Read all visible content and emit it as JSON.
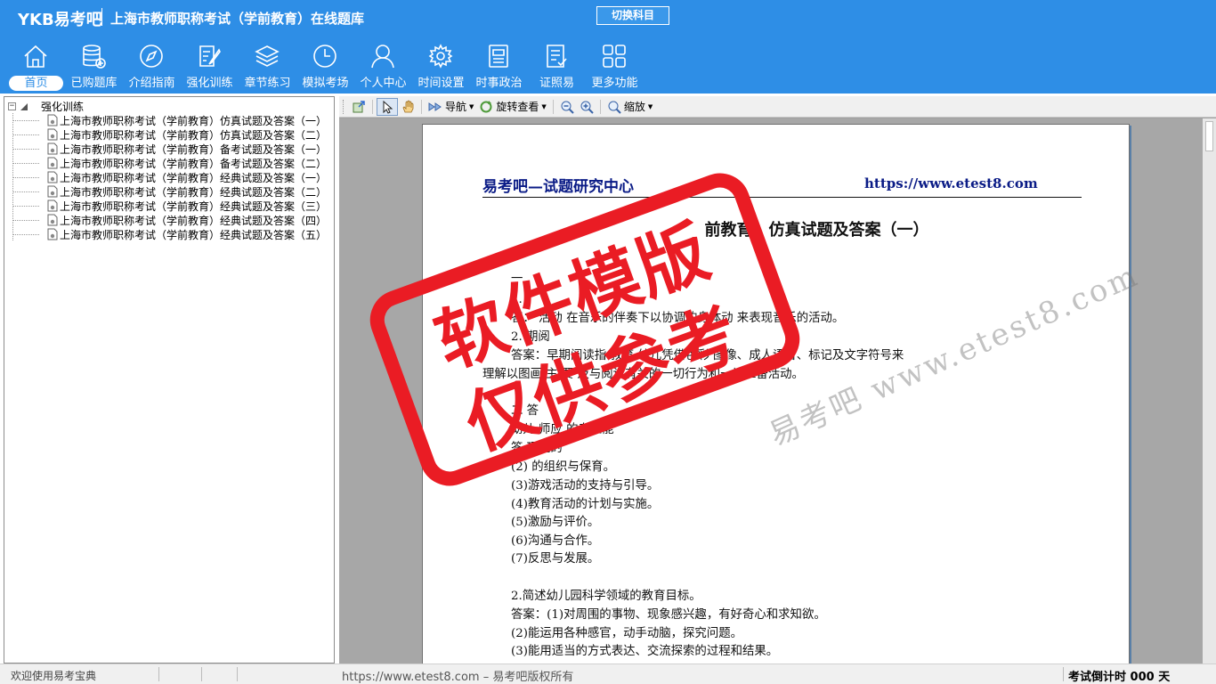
{
  "app": {
    "logo": "YKB易考吧",
    "title": "上海市教师职称考试（学前教育）在线题库",
    "switch_label": "切换科目"
  },
  "nav": [
    {
      "label": "首页",
      "icon": "home-icon"
    },
    {
      "label": "已购题库",
      "icon": "database-icon"
    },
    {
      "label": "介绍指南",
      "icon": "compass-icon"
    },
    {
      "label": "强化训练",
      "icon": "edit-icon"
    },
    {
      "label": "章节练习",
      "icon": "layers-icon"
    },
    {
      "label": "模拟考场",
      "icon": "clock-icon"
    },
    {
      "label": "个人中心",
      "icon": "user-icon"
    },
    {
      "label": "时间设置",
      "icon": "gear-icon"
    },
    {
      "label": "时事政治",
      "icon": "news-icon"
    },
    {
      "label": "证照易",
      "icon": "checklist-icon"
    },
    {
      "label": "更多功能",
      "icon": "grid-icon"
    }
  ],
  "tree": {
    "root": "强化训练",
    "expander": "−",
    "items": [
      "上海市教师职称考试（学前教育）仿真试题及答案（一）",
      "上海市教师职称考试（学前教育）仿真试题及答案（二）",
      "上海市教师职称考试（学前教育）备考试题及答案（一）",
      "上海市教师职称考试（学前教育）备考试题及答案（二）",
      "上海市教师职称考试（学前教育）经典试题及答案（一）",
      "上海市教师职称考试（学前教育）经典试题及答案（二）",
      "上海市教师职称考试（学前教育）经典试题及答案（三）",
      "上海市教师职称考试（学前教育）经典试题及答案（四）",
      "上海市教师职称考试（学前教育）经典试题及答案（五）"
    ]
  },
  "toolbar": {
    "nav_label": "导航",
    "rotate_label": "旋转查看",
    "zoom_label": "缩放"
  },
  "document": {
    "header_left": "易考吧—试题研究中心",
    "header_right": "https://www.etest8.com",
    "title": "前教育）仿真试题及答案（一）",
    "lines": [
      "一",
      "1.",
      "答：      活动      在音乐的伴奏下以协调的身体动      来表现音乐的活动。",
      "2.   期阅",
      "答案：早期阅读指        教育     幼儿凭借色彩    图像、成人语言、标记及文字符号来",
      "理解以图画    主       要                     及与阅读有关的一切行为和一切准备活动。",
      "二     答",
      "幼儿        师应      的专业能",
      "答       环境的",
      "(2)       的组织与保育。",
      "(3)游戏活动的支持与引导。",
      "(4)教育活动的计划与实施。",
      "(5)激励与评价。",
      "(6)沟通与合作。",
      "(7)反思与发展。",
      "2.简述幼儿园科学领域的教育目标。",
      "答案：(1)对周围的事物、现象感兴趣，有好奇心和求知欲。",
      "(2)能运用各种感官，动手动脑，探究问题。",
      "(3)能用适当的方式表达、交流探索的过程和结果。"
    ]
  },
  "watermark": {
    "stamp_line1": "软件模版",
    "stamp_line2": "仅供参考",
    "site_text": "易考吧  www.etest8.com"
  },
  "statusbar": {
    "welcome": "欢迎使用易考宝典",
    "copyright": "https://www.etest8.com – 易考吧版权所有",
    "countdown": "考试倒计时 000 天"
  },
  "colors": {
    "header_blue": "#2e8ee6",
    "stamp_red": "#ea1c24",
    "doc_header_navy": "#0a1b86"
  }
}
